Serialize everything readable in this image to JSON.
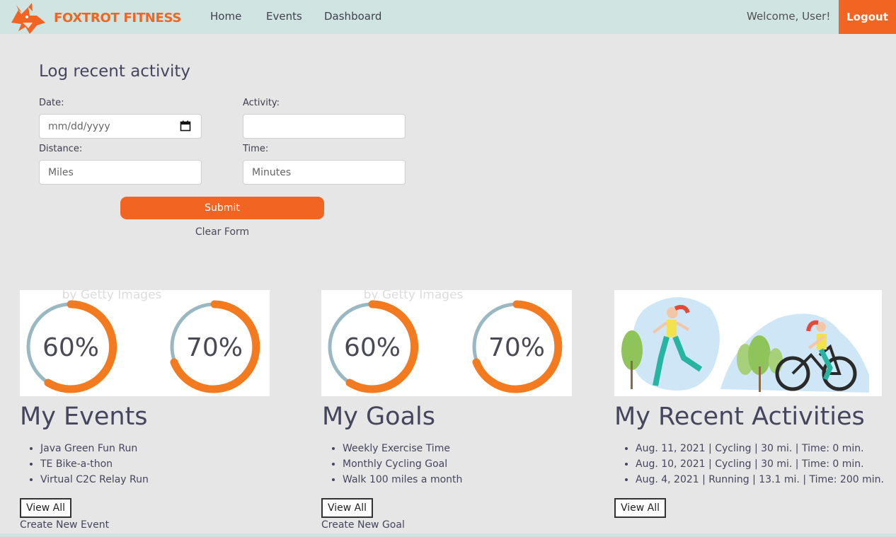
{
  "brand": {
    "name": "FOXTROT FITNESS",
    "color": "#f26422"
  },
  "nav": {
    "links": [
      "Home",
      "Events",
      "Dashboard"
    ],
    "welcome": "Welcome, User!",
    "logout": "Logout"
  },
  "form": {
    "title": "Log recent activity",
    "date_label": "Date:",
    "date_placeholder": "mm/dd/yyyy",
    "activity_label": "Activity:",
    "activity_value": "",
    "distance_label": "Distance:",
    "distance_placeholder": "Miles",
    "time_label": "Time:",
    "time_placeholder": "Minutes",
    "submit": "Submit",
    "clear": "Clear Form"
  },
  "gauges": {
    "left": "60%",
    "right": "70%",
    "watermark": "by Getty Images"
  },
  "events": {
    "title": "My Events",
    "items": [
      "Java Green Fun Run",
      "TE Bike-a-thon",
      "Virtual C2C Relay Run"
    ],
    "view_all": "View All",
    "create": "Create New Event"
  },
  "goals": {
    "title": "My Goals",
    "items": [
      "Weekly Exercise Time",
      "Monthly Cycling Goal",
      "Walk 100 miles a month"
    ],
    "view_all": "View All",
    "create": "Create New Goal"
  },
  "activities": {
    "title": "My Recent Activities",
    "items": [
      "Aug. 11, 2021 | Cycling | 30 mi. | Time: 0 min.",
      "Aug. 10, 2021 | Cycling | 30 mi. | Time: 0 min.",
      "Aug. 4, 2021 | Running | 13.1 mi. | Time: 200 min."
    ],
    "view_all": "View All"
  },
  "colors": {
    "accent": "#f26422",
    "navbar": "#d0e5e1",
    "background": "#e6e6e6"
  }
}
